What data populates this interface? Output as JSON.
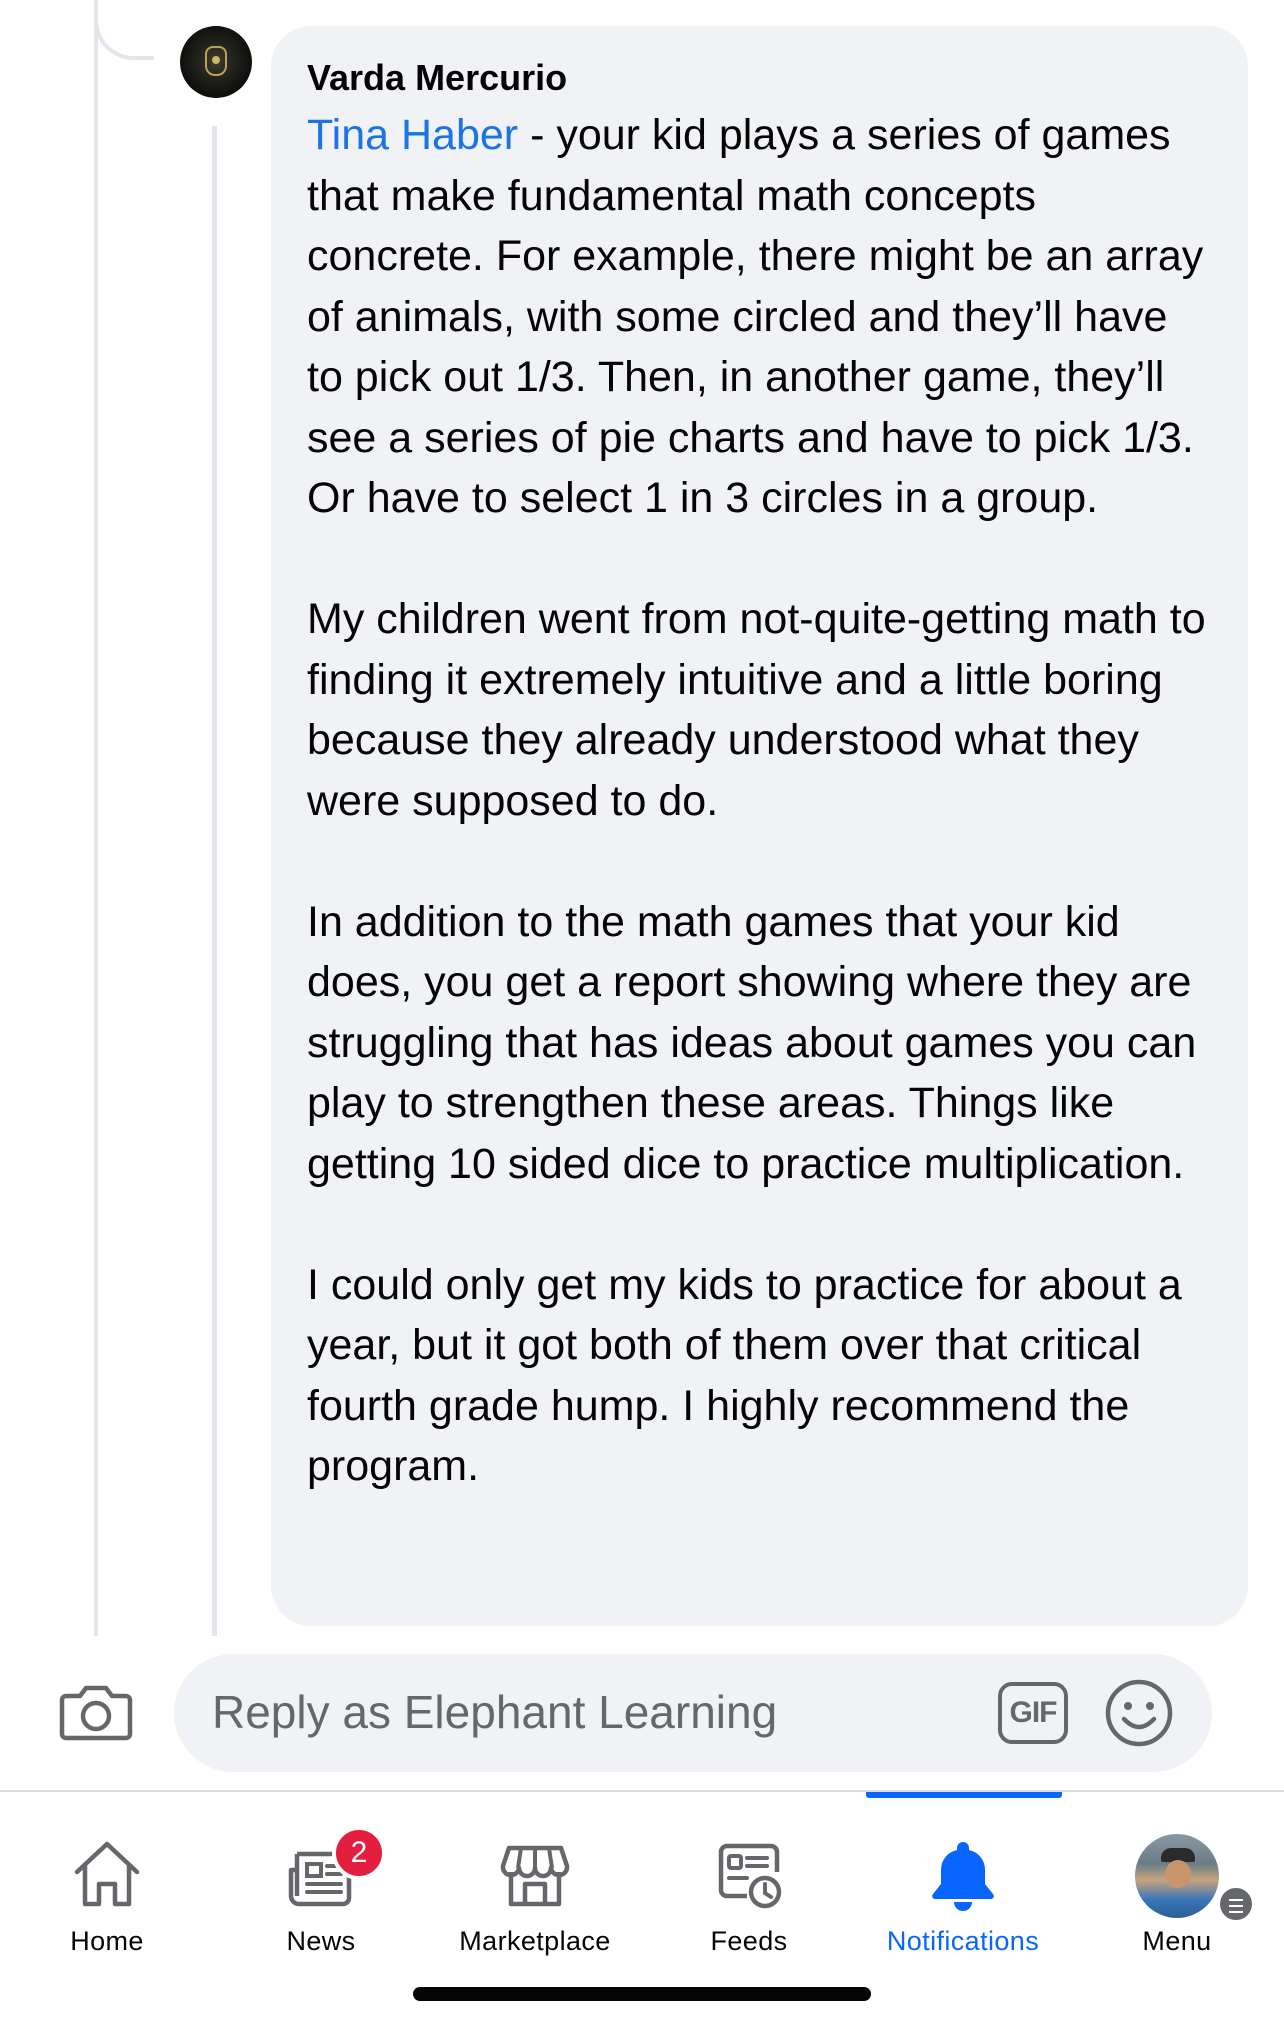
{
  "comment": {
    "author": "Varda Mercurio",
    "mention": "Tina Haber",
    "first_paragraph_rest": " - your kid plays a series of games that make fundamental math concepts concrete. For example, there might be an array of animals, with some circled and they’ll have to pick out 1/3. Then, in another game, they’ll see a series of pie charts and have to pick 1/3. Or have to select 1 in 3 circles in a group.",
    "paragraphs": [
      "My children went from not-quite-getting math to finding it extremely intuitive and a little boring because they already understood what they were supposed to do.",
      "In addition to the math games that your kid does, you get a report showing where they are struggling that has ideas about games you can play to strengthen these areas. Things like getting 10 sided dice to practice multiplication.",
      "I could only get my kids to practice for about a year, but it got both of them over that critical fourth grade hump. I highly recommend the program."
    ]
  },
  "composer": {
    "placeholder": "Reply as Elephant Learning",
    "gif_label": "GIF",
    "camera_icon": "camera-icon",
    "emoji_icon": "smiley-icon"
  },
  "nav": {
    "active_tab": "Notifications",
    "accent_color": "#0866ff",
    "tabs": [
      {
        "label": "Home",
        "icon": "home-icon"
      },
      {
        "label": "News",
        "icon": "news-icon",
        "badge": "2"
      },
      {
        "label": "Marketplace",
        "icon": "marketplace-icon"
      },
      {
        "label": "Feeds",
        "icon": "feeds-icon"
      },
      {
        "label": "Notifications",
        "icon": "bell-icon"
      },
      {
        "label": "Menu",
        "icon": "profile-avatar"
      }
    ]
  }
}
